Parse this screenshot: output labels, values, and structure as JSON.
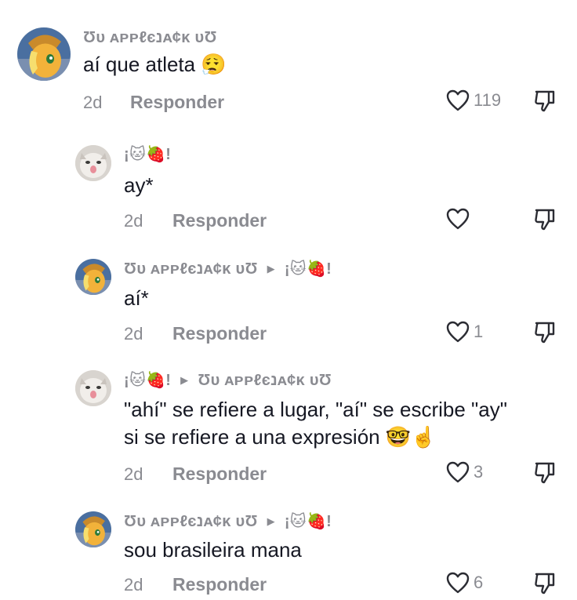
{
  "comments": [
    {
      "user": "Ʊᴜ ᴀᴘᴘℓєנᴀ¢ᴋ ᴜƱ",
      "reply_to": "",
      "text": "aí que atleta 😮‍💨",
      "date": "2d",
      "reply_label": "Responder",
      "likes": "119"
    },
    {
      "user": "¡🐱🍓!",
      "reply_to": "",
      "text": "ay*",
      "date": "2d",
      "reply_label": "Responder",
      "likes": ""
    },
    {
      "user": "Ʊᴜ ᴀᴘᴘℓєנᴀ¢ᴋ ᴜƱ",
      "reply_to": "¡🐱🍓!",
      "text": "aí*",
      "date": "2d",
      "reply_label": "Responder",
      "likes": "1"
    },
    {
      "user": "¡🐱🍓!",
      "reply_to": "Ʊᴜ ᴀᴘᴘℓєנᴀ¢ᴋ ᴜƱ",
      "text_line1": "\"ahí\" se refiere a lugar, \"aí\" se escribe \"ay\"",
      "text_line2": "si se refiere a una expresión 🤓☝️",
      "date": "2d",
      "reply_label": "Responder",
      "likes": "3"
    },
    {
      "user": "Ʊᴜ ᴀᴘᴘℓєנᴀ¢ᴋ ᴜƱ",
      "reply_to": "¡🐱🍓!",
      "text": "sou brasileira mana",
      "date": "2d",
      "reply_label": "Responder",
      "likes": "6"
    }
  ],
  "icons": {
    "like": "heart-outline-icon",
    "dislike": "thumbs-down-icon",
    "reply_arrow": "triangle-right-icon"
  }
}
